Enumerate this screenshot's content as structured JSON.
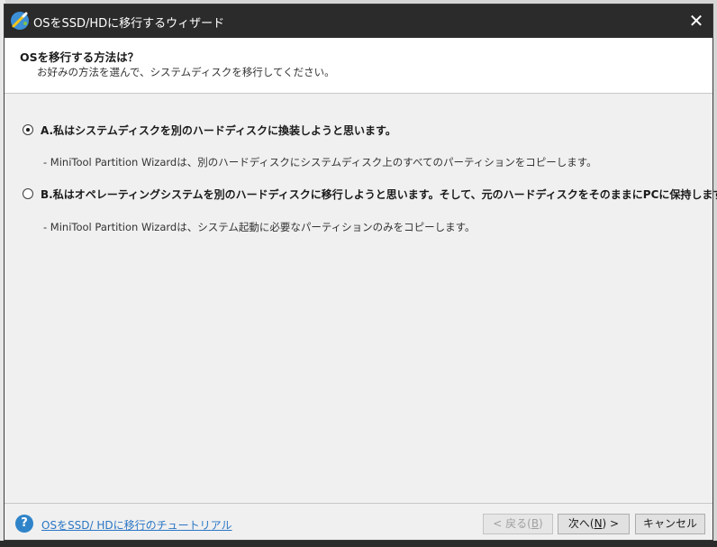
{
  "window": {
    "title": "OSをSSD/HDに移行するウィザード",
    "close_glyph": "✕",
    "app_icon": "wand-icon"
  },
  "header": {
    "title": "OSを移行する方法は？",
    "subtitle": "お好みの方法を選んで、システムディスクを移行してください。"
  },
  "options": [
    {
      "label": "A.私はシステムディスクを別のハードディスクに換装しようと思います。",
      "description": "- MiniTool Partition Wizardは、別のハードディスクにシステムディスク上のすべてのパーティションをコピーします。",
      "selected": true
    },
    {
      "label": "B.私はオペレーティングシステムを別のハードディスクに移行しようと思います。そして、元のハードディスクをそのままにPCに保持します。",
      "description": "- MiniTool Partition Wizardは、システム起動に必要なパーティションのみをコピーします。",
      "selected": false
    }
  ],
  "footer": {
    "help_glyph": "?",
    "help_link": "OSをSSD/ HDに移行のチュートリアル",
    "back": {
      "pre": "< 戻る(",
      "key": "B",
      "post": ")",
      "enabled": false
    },
    "next": {
      "pre": "次へ(",
      "key": "N",
      "post": ") >",
      "enabled": true
    },
    "cancel": "キャンセル"
  },
  "colors": {
    "titlebar": "#2b2b2b",
    "link": "#2a76c4",
    "help_icon": "#2f84c9"
  }
}
